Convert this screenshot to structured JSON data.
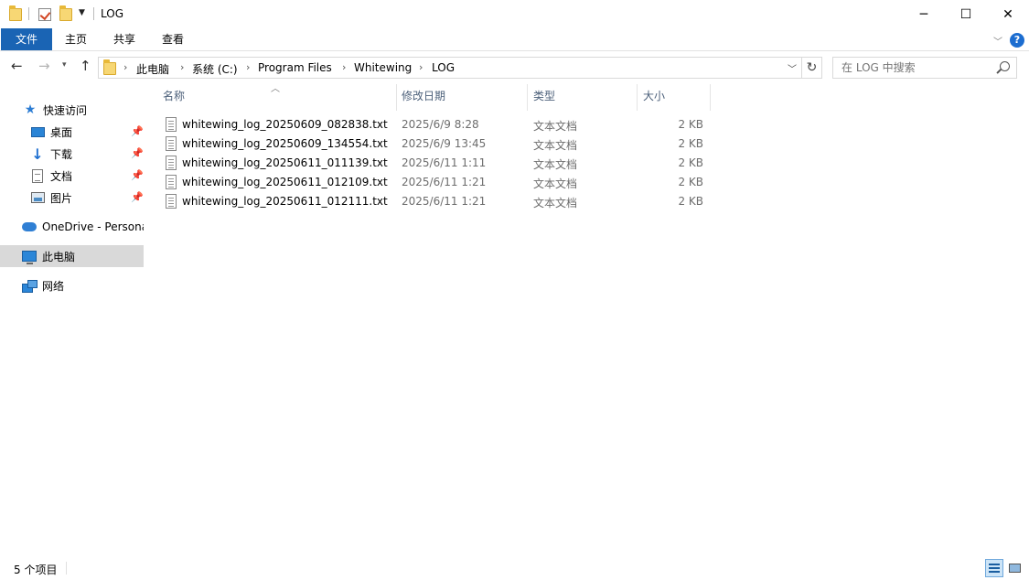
{
  "window": {
    "title": "LOG",
    "minimize_glyph": "─",
    "maximize_glyph": "☐",
    "close_glyph": "✕"
  },
  "ribbon": {
    "tabs": [
      "文件",
      "主页",
      "共享",
      "查看"
    ],
    "help_glyph": "?"
  },
  "address": {
    "crumbs": [
      "此电脑",
      "系统 (C:)",
      "Program Files",
      "Whitewing",
      "LOG"
    ]
  },
  "search": {
    "placeholder": "在 LOG 中搜索"
  },
  "sidebar": {
    "quick_access": "快速访问",
    "pinned": [
      "桌面",
      "下载",
      "文档",
      "图片"
    ],
    "onedrive": "OneDrive - Personal",
    "this_pc": "此电脑",
    "network": "网络"
  },
  "columns": {
    "name": "名称",
    "date": "修改日期",
    "type": "类型",
    "size": "大小"
  },
  "files": [
    {
      "name": "whitewing_log_20250609_082838.txt",
      "date": "2025/6/9 8:28",
      "type": "文本文档",
      "size": "2 KB"
    },
    {
      "name": "whitewing_log_20250609_134554.txt",
      "date": "2025/6/9 13:45",
      "type": "文本文档",
      "size": "2 KB"
    },
    {
      "name": "whitewing_log_20250611_011139.txt",
      "date": "2025/6/11 1:11",
      "type": "文本文档",
      "size": "2 KB"
    },
    {
      "name": "whitewing_log_20250611_012109.txt",
      "date": "2025/6/11 1:21",
      "type": "文本文档",
      "size": "2 KB"
    },
    {
      "name": "whitewing_log_20250611_012111.txt",
      "date": "2025/6/11 1:21",
      "type": "文本文档",
      "size": "2 KB"
    }
  ],
  "status": {
    "item_count": "5 个项目"
  }
}
